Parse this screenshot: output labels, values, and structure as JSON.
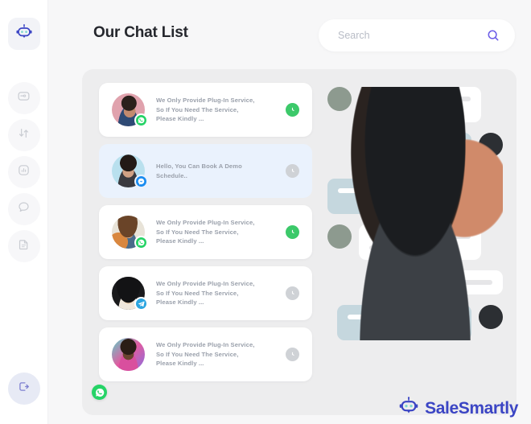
{
  "app": {
    "brand_name": "SaleSmartly",
    "brand_color": "#3b45c4",
    "accent_color": "#5b4de0",
    "background": "#f7f7f8"
  },
  "sidebar": {
    "brand_icon": "robot-icon",
    "items": [
      {
        "icon": "inbox-icon",
        "name": "inbox"
      },
      {
        "icon": "transfer-icon",
        "name": "transfer"
      },
      {
        "icon": "analytics-icon",
        "name": "analytics"
      },
      {
        "icon": "chat-bubble-icon",
        "name": "chat"
      },
      {
        "icon": "document-icon",
        "name": "documents"
      }
    ],
    "logout": {
      "icon": "logout-icon",
      "name": "logout"
    }
  },
  "header": {
    "title": "Our Chat List"
  },
  "search": {
    "placeholder": "Search",
    "value": "",
    "icon": "search-icon"
  },
  "chat_list": [
    {
      "message": "We Only Provide Plug-In Service, So If You Need The Service, Please Kindly ...",
      "channel": "whatsapp",
      "status_icon": "clock-icon",
      "status_color": "green",
      "selected": false
    },
    {
      "message": "Hello, You Can Book A Demo Schedule..",
      "channel": "messenger",
      "status_icon": "clock-icon",
      "status_color": "grey",
      "selected": true
    },
    {
      "message": "We Only Provide Plug-In Service, So If You Need The Service, Please Kindly ...",
      "channel": "whatsapp",
      "status_icon": "clock-icon",
      "status_color": "green",
      "selected": false
    },
    {
      "message": "We Only Provide Plug-In Service, So If You Need The Service, Please Kindly ...",
      "channel": "telegram",
      "status_icon": "clock-icon",
      "status_color": "grey",
      "selected": false
    },
    {
      "message": "We Only Provide Plug-In Service, So If You Need The Service, Please Kindly ...",
      "channel": "whatsapp",
      "status_icon": "clock-icon",
      "status_color": "grey",
      "selected": false
    }
  ],
  "floating_badge": {
    "icon": "whatsapp-icon",
    "color": "#25d366"
  },
  "conversation": {
    "bubble_in_color": "#ffffff",
    "bubble_out_color": "#c5d7de",
    "messages": [
      {
        "side": "in",
        "avatar": "woman",
        "lines": [
          100,
          58
        ]
      },
      {
        "side": "out",
        "avatar": "man",
        "lines": [
          100,
          57
        ]
      },
      {
        "side": "out",
        "avatar": null,
        "lines": [
          100,
          65
        ]
      },
      {
        "side": "in",
        "avatar": "woman",
        "lines": [
          100,
          55
        ]
      },
      {
        "side": "in",
        "avatar": null,
        "lines": [
          100
        ]
      },
      {
        "side": "out",
        "avatar": "man",
        "lines": [
          100,
          56
        ]
      }
    ]
  }
}
